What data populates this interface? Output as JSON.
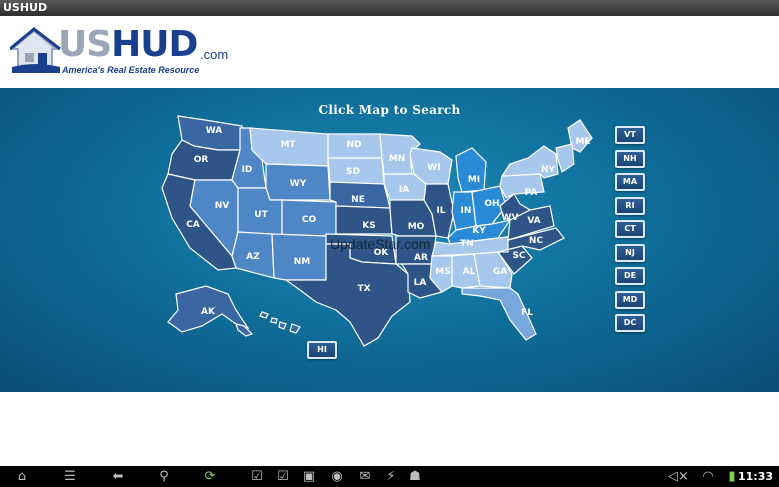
{
  "window": {
    "title": "USHUD"
  },
  "logo": {
    "us": "US",
    "hud": "HUD",
    "com": ".com",
    "tagline": "America's Real Estate Resource"
  },
  "map": {
    "title": "Click Map to Search",
    "watermark": "UpdateStar.com",
    "states": {
      "WA": "WA",
      "OR": "OR",
      "CA": "CA",
      "ID": "ID",
      "NV": "NV",
      "MT": "MT",
      "WY": "WY",
      "UT": "UT",
      "AZ": "AZ",
      "CO": "CO",
      "NM": "NM",
      "ND": "ND",
      "SD": "SD",
      "NE": "NE",
      "KS": "KS",
      "OK": "OK",
      "TX": "TX",
      "MN": "MN",
      "IA": "IA",
      "MO": "MO",
      "AR": "AR",
      "LA": "LA",
      "WI": "WI",
      "IL": "IL",
      "MI": "MI",
      "IN": "IN",
      "OH": "OH",
      "KY": "KY",
      "TN": "TN",
      "MS": "MS",
      "AL": "AL",
      "GA": "GA",
      "FL": "FL",
      "SC": "SC",
      "NC": "NC",
      "VA": "VA",
      "WV": "WV",
      "PA": "PA",
      "NY": "NY",
      "ME": "ME",
      "AK": "AK",
      "HI": "HI"
    },
    "small_states": [
      "VT",
      "NH",
      "MA",
      "RI",
      "CT",
      "NJ",
      "DE",
      "MD",
      "DC"
    ]
  },
  "navbar": {
    "icons": [
      "home-icon",
      "menu-icon",
      "back-icon",
      "search-icon",
      "update-icon",
      "task-icon",
      "check-icon",
      "bag-icon",
      "chat-icon",
      "mail-icon",
      "usb-icon",
      "android-icon",
      "volume-icon",
      "wifi-icon",
      "battery-icon"
    ],
    "clock": "11:33"
  }
}
